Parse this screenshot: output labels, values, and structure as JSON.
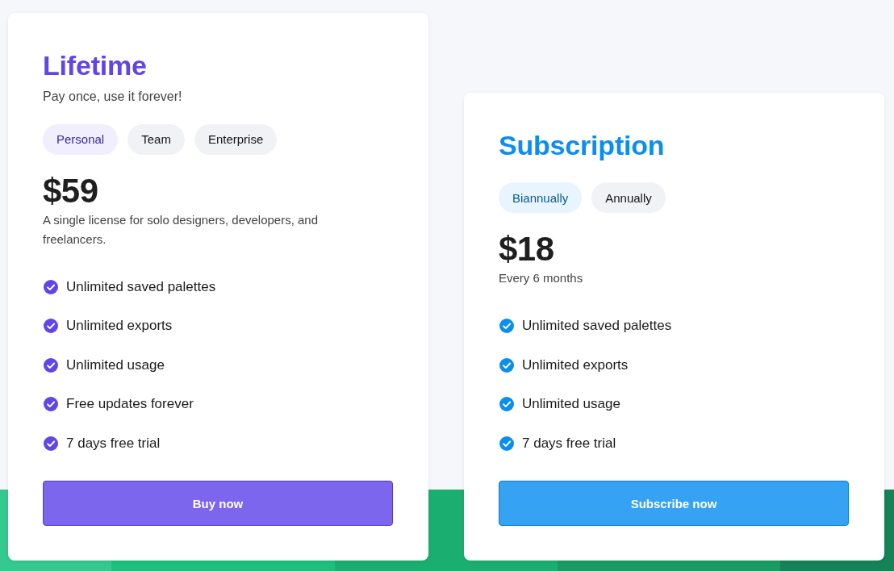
{
  "plans": [
    {
      "title": "Lifetime",
      "color": "#5f45ea",
      "subtitle": "Pay once, use it forever!",
      "options": [
        {
          "label": "Personal",
          "selected": true
        },
        {
          "label": "Team",
          "selected": false
        },
        {
          "label": "Enterprise",
          "selected": false
        }
      ],
      "price": "$59",
      "description": "A single license for solo designers, developers, and freelancers.",
      "features": [
        "Unlimited saved palettes",
        "Unlimited exports",
        "Unlimited usage",
        "Free updates forever",
        "7 days free trial"
      ],
      "button": "Buy now"
    },
    {
      "title": "Subscription",
      "color": "#0a8ef0",
      "options": [
        {
          "label": "Biannually",
          "selected": true
        },
        {
          "label": "Annually",
          "selected": false
        }
      ],
      "price": "$18",
      "description": "Every 6 months",
      "features": [
        "Unlimited saved palettes",
        "Unlimited exports",
        "Unlimited usage",
        "7 days free trial"
      ],
      "button": "Subscribe now"
    }
  ]
}
